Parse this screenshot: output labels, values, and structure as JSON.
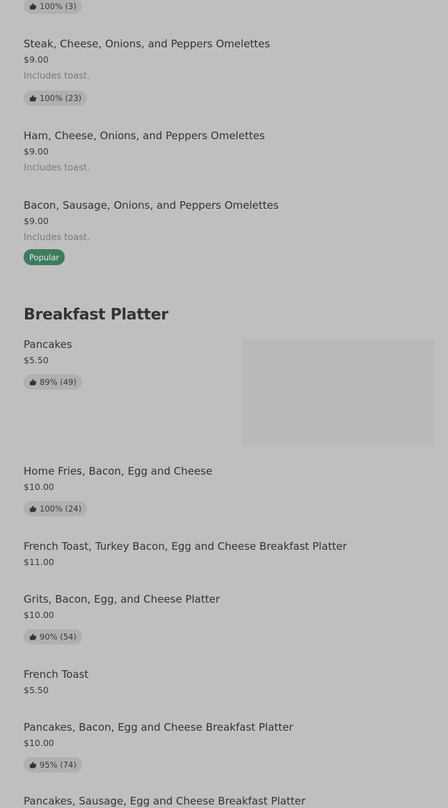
{
  "top_badge": {
    "text": "100% (3)"
  },
  "items_before": [
    {
      "name": "Steak, Cheese, Onions, and Peppers Omelettes",
      "price": "$9.00",
      "desc": "Includes toast.",
      "rating": "100% (23)"
    },
    {
      "name": "Ham, Cheese, Onions, and Peppers Omelettes",
      "price": "$9.00",
      "desc": "Includes toast."
    },
    {
      "name": "Bacon, Sausage, Onions, and Peppers Omelettes",
      "price": "$9.00",
      "desc": "Includes toast.",
      "tag": "Popular"
    }
  ],
  "section": {
    "title": "Breakfast Platter"
  },
  "platter_items": [
    {
      "name": "Pancakes",
      "price": "$5.50",
      "rating": "89% (49)"
    },
    {
      "name": "Home Fries, Bacon, Egg and Cheese",
      "price": "$10.00",
      "rating": "100% (24)"
    },
    {
      "name": "French Toast, Turkey Bacon, Egg and Cheese Breakfast Platter",
      "price": "$11.00"
    },
    {
      "name": "Grits, Bacon, Egg, and Cheese Platter",
      "price": "$10.00",
      "rating": "90% (54)"
    },
    {
      "name": "French Toast",
      "price": "$5.50"
    },
    {
      "name": "Pancakes, Bacon, Egg and Cheese Breakfast Platter",
      "price": "$10.00",
      "rating": "95% (74)"
    },
    {
      "name": "Pancakes, Sausage, Egg and Cheese Breakfast Platter"
    }
  ],
  "icons": {
    "rating": "thumbs-up-icon"
  }
}
